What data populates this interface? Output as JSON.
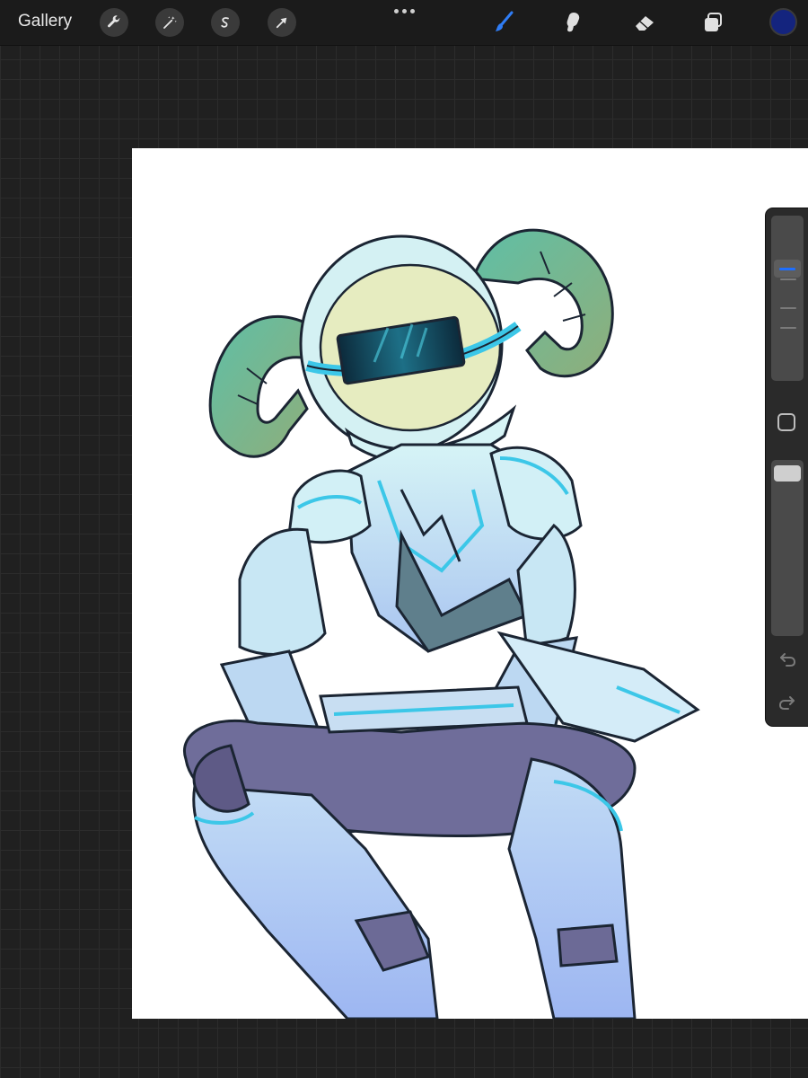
{
  "app": {
    "gallery_label": "Gallery"
  },
  "toolbar": {
    "left_tools": [
      {
        "icon": "wrench-icon"
      },
      {
        "icon": "magic-wand-icon"
      },
      {
        "icon": "selection-s-icon"
      },
      {
        "icon": "transform-arrow-icon"
      }
    ],
    "right_tools": [
      {
        "icon": "brush-icon",
        "active": true
      },
      {
        "icon": "smudge-icon",
        "active": false
      },
      {
        "icon": "eraser-icon",
        "active": false
      },
      {
        "icon": "layers-icon",
        "active": false
      }
    ],
    "current_color": "#14247e",
    "active_tool_color": "#2f7df6"
  },
  "sidebar": {
    "brush_size_level": 0.7,
    "opacity_level": 1.0
  },
  "canvas": {
    "background": "#ffffff",
    "artwork": "robot-character-illustration"
  }
}
